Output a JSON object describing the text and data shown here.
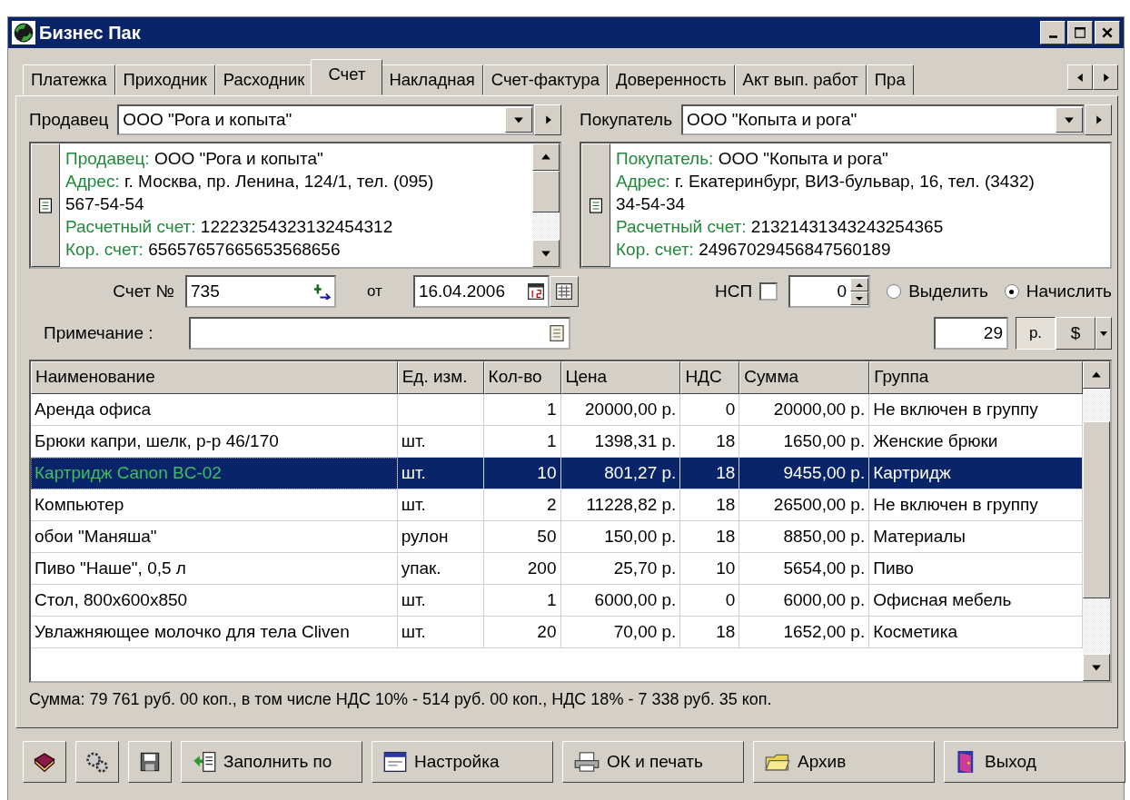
{
  "window": {
    "title": "Бизнес Пак"
  },
  "tabs": [
    {
      "label": "Платежка",
      "selected": false
    },
    {
      "label": "Приходник",
      "selected": false
    },
    {
      "label": "Расходник",
      "selected": false
    },
    {
      "label": "Счет",
      "selected": true
    },
    {
      "label": "Накладная",
      "selected": false
    },
    {
      "label": "Счет-фактура",
      "selected": false
    },
    {
      "label": "Доверенность",
      "selected": false
    },
    {
      "label": "Акт вып. работ",
      "selected": false
    },
    {
      "label": "Пра",
      "selected": false
    }
  ],
  "parties": [
    {
      "label": "Продавец",
      "value": "ООО \"Рога и копыта\"",
      "scrollbar": true,
      "lines": [
        {
          "label": "Продавец:",
          "value": "ООО \"Рога и копыта\""
        },
        {
          "label": "Адрес:",
          "value": "г. Москва, пр. Ленина, 124/1, тел. (095)"
        },
        {
          "value": "567-54-54"
        },
        {
          "label": "Расчетный счет:",
          "value": "12223254323132454312"
        },
        {
          "label": "Кор. счет:",
          "value": "65657657665653568656"
        }
      ]
    },
    {
      "label": "Покупатель",
      "value": "ООО \"Копыта и рога\"",
      "scrollbar": false,
      "lines": [
        {
          "label": "Покупатель:",
          "value": "ООО \"Копыта и рога\""
        },
        {
          "label": "Адрес:",
          "value": "г. Екатеринбург, ВИЗ-бульвар, 16, тел. (3432)"
        },
        {
          "value": "34-54-34"
        },
        {
          "label": "Расчетный счет:",
          "value": "21321431343243254365"
        },
        {
          "label": "Кор. счет:",
          "value": "24967029456847560189"
        }
      ]
    }
  ],
  "invoice": {
    "number_label": "Счет №",
    "number": "735",
    "date_label": "от",
    "date": "16.04.2006",
    "note_label": "Примечание :"
  },
  "tax": {
    "label": "НСП",
    "checked": false,
    "rate": "0",
    "options": [
      {
        "label": "Выделить",
        "selected": false
      },
      {
        "label": "Начислить",
        "selected": true
      }
    ],
    "amount": "29",
    "currencies": [
      {
        "label": "р.",
        "selected": true
      },
      {
        "label": "$",
        "selected": false
      }
    ]
  },
  "table": {
    "columns": [
      "Наименование",
      "Ед. изм.",
      "Кол-во",
      "Цена",
      "НДС",
      "Сумма",
      "Группа"
    ],
    "rows": [
      {
        "cells": [
          "Аренда офиса",
          "",
          "1",
          "20000,00 р.",
          "0",
          "20000,00 р.",
          "Не включен в группу"
        ],
        "selected": false
      },
      {
        "cells": [
          "Брюки капри, шелк, р-р 46/170",
          "шт.",
          "1",
          "1398,31 р.",
          "18",
          "1650,00 р.",
          "Женские брюки"
        ],
        "selected": false
      },
      {
        "cells": [
          "Картридж  Canon BC-02",
          "шт.",
          "10",
          "801,27 р.",
          "18",
          "9455,00 р.",
          "Картридж"
        ],
        "selected": true
      },
      {
        "cells": [
          "Компьютер",
          "шт.",
          "2",
          "11228,82 р.",
          "18",
          "26500,00 р.",
          "Не включен в группу"
        ],
        "selected": false
      },
      {
        "cells": [
          "обои \"Маняша\"",
          "рулон",
          "50",
          "150,00 р.",
          "18",
          "8850,00 р.",
          "Материалы"
        ],
        "selected": false
      },
      {
        "cells": [
          "Пиво \"Наше\", 0,5 л",
          "упак.",
          "200",
          "25,70 р.",
          "10",
          "5654,00 р.",
          "Пиво"
        ],
        "selected": false
      },
      {
        "cells": [
          "Стол, 800x600x850",
          "шт.",
          "1",
          "6000,00 р.",
          "0",
          "6000,00 р.",
          "Офисная мебель"
        ],
        "selected": false
      },
      {
        "cells": [
          "Увлажняющее молочко для тела Cliven",
          "шт.",
          "20",
          "70,00 р.",
          "18",
          "1652,00 р.",
          "Косметика"
        ],
        "selected": false
      }
    ]
  },
  "summary": "Сумма: 79 761 руб. 00 коп., в том числе НДС 10% - 514 руб. 00 коп., НДС 18% - 7 338 руб. 35 коп.",
  "toolbar": [
    {
      "kind": "book"
    },
    {
      "kind": "gears"
    },
    {
      "kind": "floppy"
    },
    {
      "kind": "fill",
      "label": "Заполнить по"
    },
    {
      "kind": "settings",
      "label": "Настройка"
    },
    {
      "kind": "print",
      "label": "ОК и печать"
    },
    {
      "kind": "archive",
      "label": "Архив"
    },
    {
      "kind": "exit",
      "label": "Выход"
    }
  ]
}
